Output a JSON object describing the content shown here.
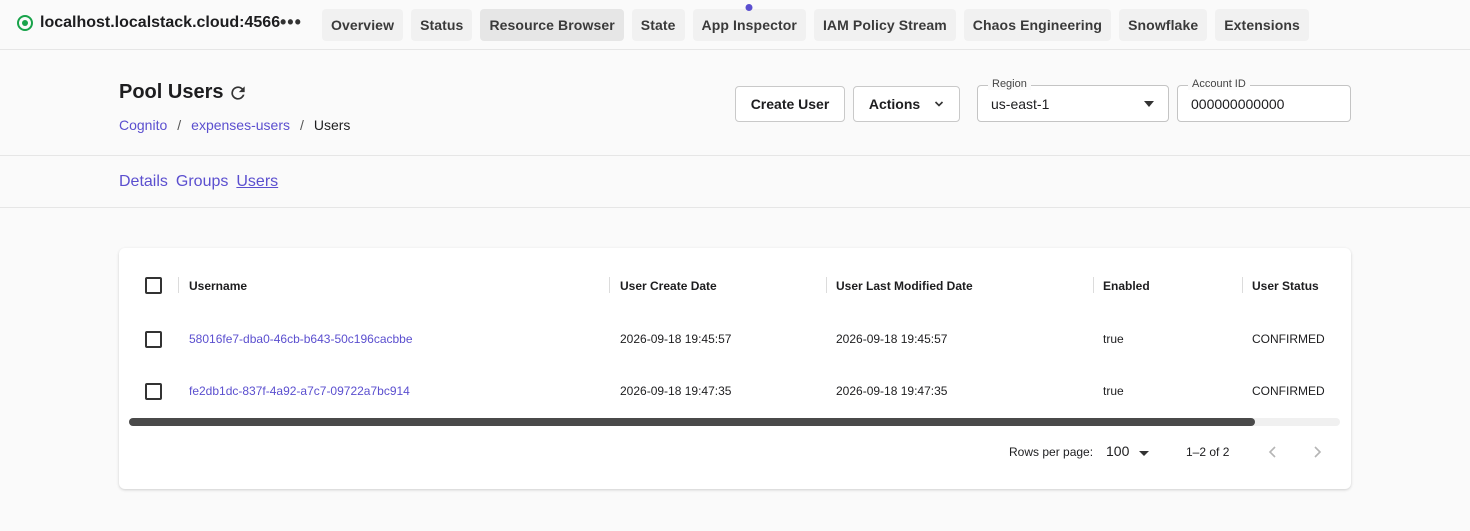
{
  "topbar": {
    "host": "localhost.localstack.cloud:4566",
    "status_color": "#18a34a",
    "more_icon": "more-horizontal-icon",
    "tabs": [
      {
        "label": "Overview"
      },
      {
        "label": "Status"
      },
      {
        "label": "Resource Browser",
        "active": true
      },
      {
        "label": "State"
      },
      {
        "label": "App Inspector",
        "has_dot": true
      },
      {
        "label": "IAM Policy Stream"
      },
      {
        "label": "Chaos Engineering"
      },
      {
        "label": "Snowflake"
      },
      {
        "label": "Extensions"
      }
    ]
  },
  "header": {
    "title": "Pool Users",
    "refresh_icon": "refresh-icon",
    "breadcrumb": [
      "Cognito",
      "expenses-users",
      "Users"
    ],
    "breadcrumb_sep": "/",
    "create_label": "Create User",
    "actions_label": "Actions",
    "region_label": "Region",
    "region_value": "us-east-1",
    "account_label": "Account ID",
    "account_value": "000000000000"
  },
  "subtabs": [
    {
      "label": "Details"
    },
    {
      "label": "Groups"
    },
    {
      "label": "Users",
      "active": true
    }
  ],
  "table": {
    "columns": [
      "Username",
      "User Create Date",
      "User Last Modified Date",
      "Enabled",
      "User Status"
    ],
    "rows": [
      [
        "58016fe7-dba0-46cb-b643-50c196cacbbe",
        "2026-09-18 19:45:57",
        "2026-09-18 19:45:57",
        "true",
        "CONFIRMED"
      ],
      [
        "fe2db1dc-837f-4a92-a7c7-09722a7bc914",
        "2026-09-18 19:47:35",
        "2026-09-18 19:47:35",
        "true",
        "CONFIRMED"
      ]
    ],
    "scroll_fraction": 0.93
  },
  "pagination": {
    "rows_per_page_label": "Rows per page:",
    "rows_per_page": "100",
    "range": "1–2 of 2"
  },
  "colors": {
    "accent": "#5b4fcf",
    "status_green": "#18a34a"
  }
}
